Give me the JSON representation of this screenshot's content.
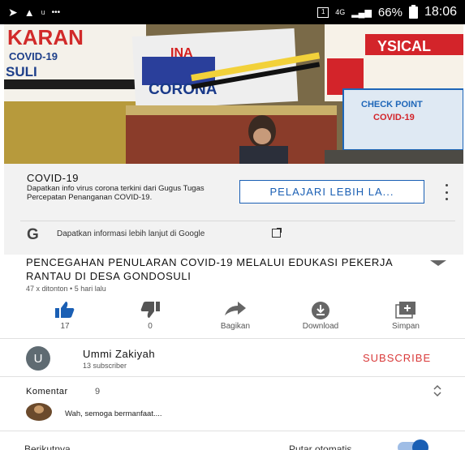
{
  "status_bar": {
    "carrier": "u",
    "battery_percent": "66%",
    "time": "18:06"
  },
  "video": {
    "banners": {
      "left_top": "KARAN",
      "left_mid": "COVID-19",
      "left_low": "SULI",
      "center_top": "INA",
      "center_main": "CORONA",
      "right_top": "YSICAL",
      "right_box_line1": "CHECK POINT",
      "right_box_line2": "COVID-19"
    }
  },
  "promo": {
    "title": "COVID-19",
    "description": "Dapatkan info virus corona terkini dari Gugus Tugas Percepatan Penanganan COVID-19.",
    "cta_label": "PELAJARI LEBIH LA...",
    "google_logo": "G",
    "google_text": "Dapatkan informasi lebih lanjut di Google"
  },
  "video_info": {
    "title": "PENCEGAHAN PENULARAN COVID-19 MELALUI EDUKASI PEKERJA RANTAU DI DESA GONDOSULI",
    "meta": "47 x ditonton • 5 hari lalu"
  },
  "actions": [
    {
      "icon": "thumbs-up-icon",
      "label": "17"
    },
    {
      "icon": "thumbs-down-icon",
      "label": "0"
    },
    {
      "icon": "share-icon",
      "label": "Bagikan"
    },
    {
      "icon": "download-icon",
      "label": "Download"
    },
    {
      "icon": "save-playlist-icon",
      "label": "Simpan"
    }
  ],
  "channel": {
    "avatar_letter": "U",
    "name": "Ummi Zakiyah",
    "subscribers": "13 subscriber",
    "subscribe_label": "SUBSCRIBE"
  },
  "comments": {
    "label": "Komentar",
    "count": "9",
    "first_comment": "Wah, semoga bermanfaat...."
  },
  "footer": {
    "up_next": "Berikutnya",
    "autoplay": "Putar otomatis"
  },
  "colors": {
    "accent_blue": "#1a5fb4",
    "subscribe_red": "#d93a3a"
  }
}
